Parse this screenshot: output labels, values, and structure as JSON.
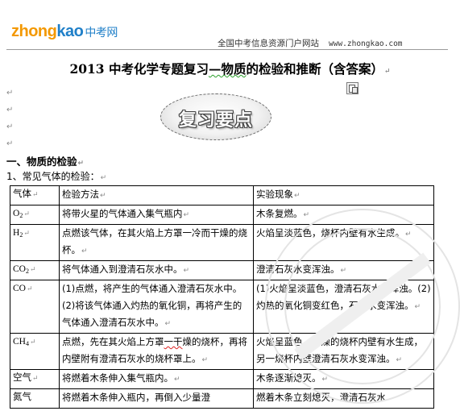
{
  "header": {
    "logo_part_a": "zhong",
    "logo_part_b": "kao",
    "logo_cn": "中考网",
    "site_slogan": "全国中考信息资源门户网站",
    "site_url": "www.zhongkao.com"
  },
  "document": {
    "title_before": "2013 中考化学专题复习",
    "title_flagged": "—物质",
    "title_after": "的检验和推断（含答案）",
    "review_badge": "复习要点",
    "section_1": "一、物质的检验",
    "subsection_1": "1、常见气体的检验：",
    "paragraph_mark": "↵"
  },
  "table": {
    "headers": [
      "气体",
      "检验方法",
      "实验现象"
    ],
    "rows": [
      {
        "gas": "O",
        "gas_sub": "2",
        "method": "将带火星的气体通入集气瓶内",
        "phenomenon": "木条复燃。"
      },
      {
        "gas": "H",
        "gas_sub": "2",
        "method": "点燃该气体，在其火焰上方罩一冷而干燥的烧杯。",
        "phenomenon": "火焰呈淡蓝色，烧杯内壁有水生成。"
      },
      {
        "gas": "CO",
        "gas_sub": "2",
        "method": "将气体通入到澄清石灰水中。",
        "phenomenon": "澄清石灰水变浑浊。"
      },
      {
        "gas": "CO",
        "gas_sub": "",
        "method": "(1)点燃，将产生的气体通入澄清石灰水中。(2)将该气体通入灼热的氧化铜，再将产生的气体通入澄清石灰水中。",
        "phenomenon": "(1)火焰呈淡蓝色，澄清石灰水变浑浊。(2)灼热的氧化铜变红色，石灰水变浑浊。"
      },
      {
        "gas": "CH",
        "gas_sub": "4",
        "method_before": "点燃，先在其火焰上方罩",
        "method_flagged": "一干",
        "method_after": "燥的烧杯，再将内壁附有澄清石灰水的烧杯罩上。",
        "phenomenon": "火焰呈蓝色，干燥的烧杯内壁有水生成，另一烧杯内壁澄清石灰水变浑浊。"
      },
      {
        "gas": "空气",
        "gas_sub": "",
        "method": "将燃着木条伸入集气瓶内。",
        "phenomenon": "木条逐渐熄灭。"
      },
      {
        "gas": "氮气",
        "gas_sub": "",
        "method": "将燃着木条伸入瓶内，再倒入少量澄",
        "phenomenon": "燃着木条立刻熄灭，澄清石灰水"
      }
    ]
  },
  "colors": {
    "logo_orange": "#f39800",
    "logo_blue": "#1f7fc8",
    "rule_gray": "#9a9a9a",
    "grammar_green": "#2ca02c",
    "spell_red": "#dd2222"
  }
}
